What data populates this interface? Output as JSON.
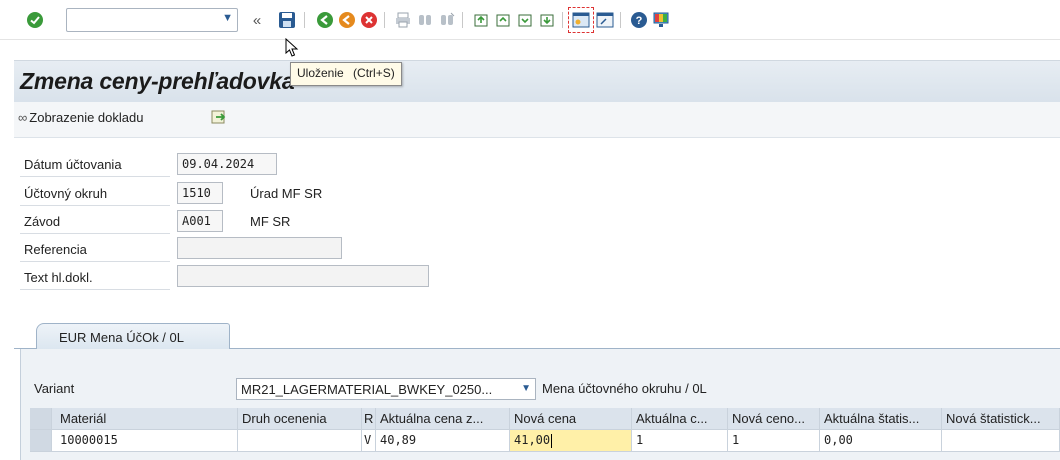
{
  "toolbar": {
    "command_field_value": "",
    "tooltip": {
      "label": "Uloženie",
      "shortcut": "(Ctrl+S)"
    },
    "colors": {
      "green": "#3a9a3a",
      "orange": "#e58a1e",
      "red": "#d33",
      "blue": "#2a5b92"
    }
  },
  "header": {
    "title": "Zmena ceny-prehľadovka"
  },
  "app_toolbar": {
    "display_doc_label": "Zobrazenie dokladu"
  },
  "form": {
    "posting_date": {
      "label": "Dátum účtovania",
      "value": "09.04.2024"
    },
    "company_code": {
      "label": "Účtovný okruh",
      "value": "1510",
      "desc": "Úrad MF SR"
    },
    "plant": {
      "label": "Závod",
      "value": "A001",
      "desc": "MF SR"
    },
    "reference": {
      "label": "Referencia",
      "value": ""
    },
    "header_text": {
      "label": "Text hl.dokl.",
      "value": ""
    }
  },
  "tab": {
    "label": "EUR  Mena ÚčOk / 0L"
  },
  "variant": {
    "label": "Variant",
    "value": "MR21_LAGERMATERIAL_BWKEY_0250...",
    "currency_label": "Mena účtovného okruhu / 0L"
  },
  "grid": {
    "headers": [
      "Materiál",
      "Druh ocenenia",
      "R",
      "Aktuálna cena z...",
      "Nová cena",
      "Aktuálna c...",
      "Nová ceno...",
      "Aktuálna štatis...",
      "Nová štatistick..."
    ],
    "rows": [
      [
        "10000015",
        "",
        "V",
        "40,89",
        "41,00",
        "1",
        "1",
        "0,00",
        ""
      ]
    ]
  }
}
